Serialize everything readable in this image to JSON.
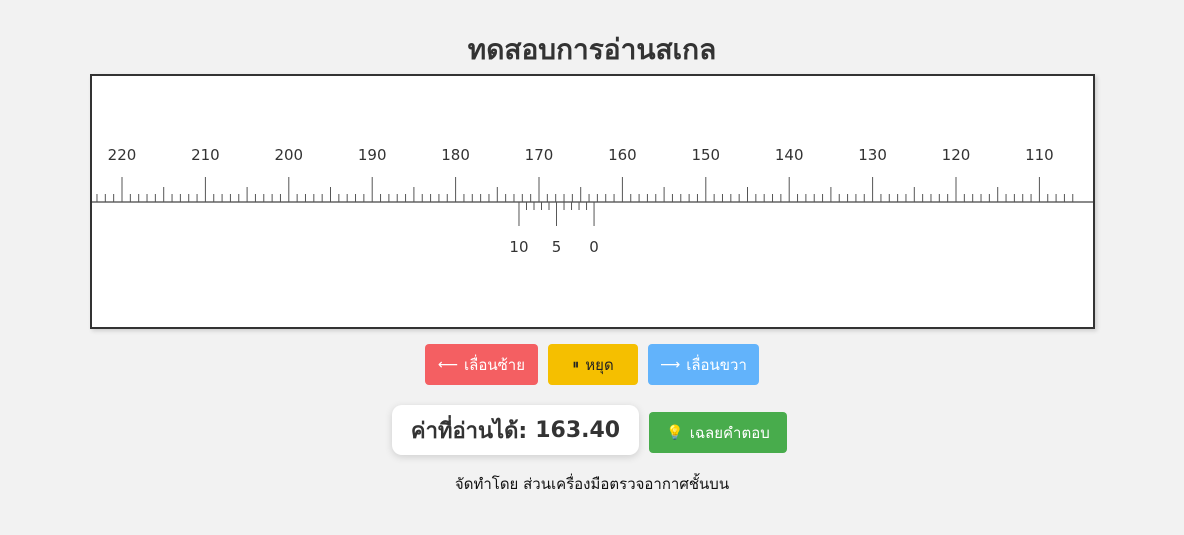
{
  "page": {
    "title": "ทดสอบการอ่านสเกล",
    "footer": "จัดทำโดย ส่วนเครื่องมือตรวจอากาศชั้นบน"
  },
  "scale": {
    "main_labels": [
      "220",
      "210",
      "200",
      "190",
      "180",
      "170",
      "160",
      "150",
      "140",
      "130",
      "120",
      "110"
    ],
    "vernier_labels": [
      "10",
      "5",
      "0"
    ],
    "vernier_zero_value": 163.4,
    "vernier_divisions": 10
  },
  "controls": {
    "left": {
      "icon": "arrow-left-icon",
      "label": "เลื่อนซ้าย"
    },
    "stop": {
      "icon": "pause-icon",
      "label": "หยุด"
    },
    "right": {
      "icon": "arrow-right-icon",
      "label": "เลื่อนขวา"
    }
  },
  "reading": {
    "label": "ค่าที่อ่านได้:",
    "value": "163.40"
  },
  "answer": {
    "icon": "lightbulb-icon",
    "label": "เฉลยคำตอบ"
  },
  "colors": {
    "left_button": "#f45f62",
    "stop_button": "#f5bf00",
    "right_button": "#62b3fb",
    "answer_button": "#48ac4c"
  }
}
